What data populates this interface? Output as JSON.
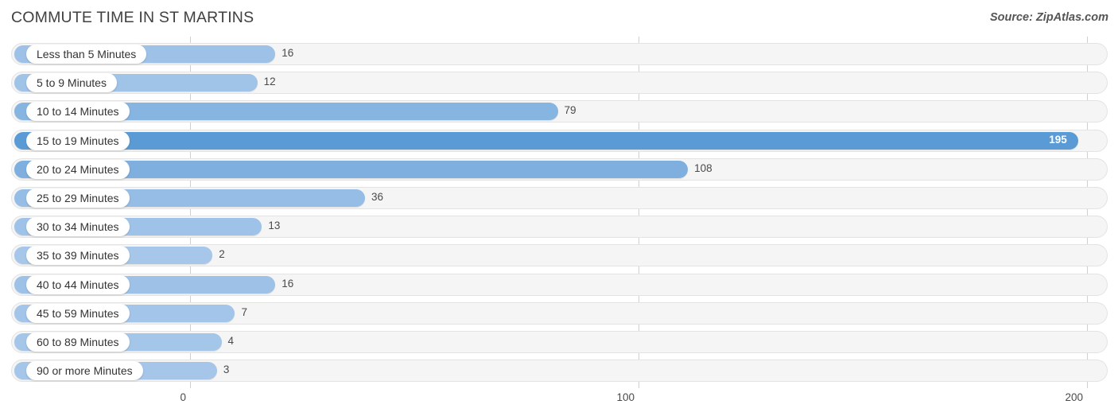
{
  "header": {
    "title": "COMMUTE TIME IN ST MARTINS",
    "source": "Source: ZipAtlas.com"
  },
  "colors": {
    "bar_light": "#a8c8ea",
    "bar_mid": "#83aede",
    "bar_max": "#5b9bd5",
    "track_bg": "#f5f5f5",
    "track_border": "#e3e3e3",
    "gridline": "#d0d0d0",
    "title_text": "#404040",
    "value_text": "#4a4a4a"
  },
  "chart_data": {
    "type": "bar",
    "orientation": "horizontal",
    "title": "COMMUTE TIME IN ST MARTINS",
    "xlabel": "",
    "ylabel": "",
    "xlim": [
      0,
      200
    ],
    "xticks": [
      0,
      100,
      200
    ],
    "xtick_labels": [
      "0",
      "100",
      "200"
    ],
    "grid": true,
    "legend": false,
    "categories": [
      "Less than 5 Minutes",
      "5 to 9 Minutes",
      "10 to 14 Minutes",
      "15 to 19 Minutes",
      "20 to 24 Minutes",
      "25 to 29 Minutes",
      "30 to 34 Minutes",
      "35 to 39 Minutes",
      "40 to 44 Minutes",
      "45 to 59 Minutes",
      "60 to 89 Minutes",
      "90 or more Minutes"
    ],
    "values": [
      16,
      12,
      79,
      195,
      108,
      36,
      13,
      2,
      16,
      7,
      4,
      3
    ],
    "value_labels": [
      "16",
      "12",
      "79",
      "195",
      "108",
      "36",
      "13",
      "2",
      "16",
      "7",
      "4",
      "3"
    ],
    "max_value": 195,
    "max_index": 3
  }
}
